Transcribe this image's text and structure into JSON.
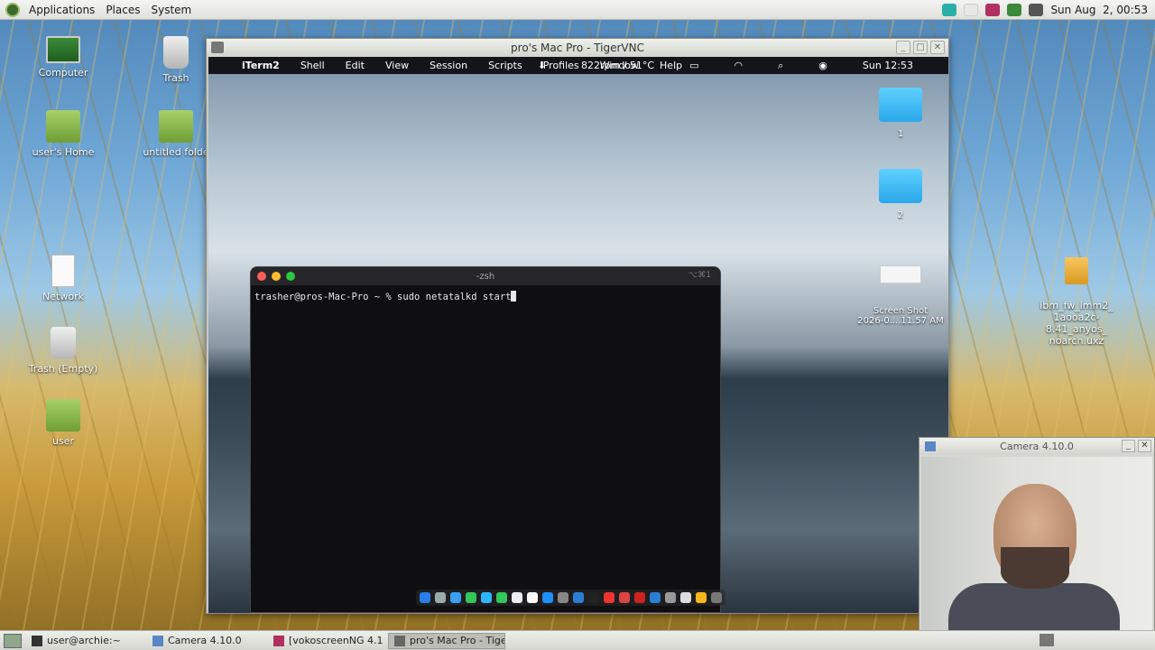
{
  "top_panel": {
    "menus": [
      "Applications",
      "Places",
      "System"
    ],
    "clock": "Sun Aug  2, 00:53"
  },
  "desktop_icons": [
    {
      "label": "Computer"
    },
    {
      "label": "Trash"
    },
    {
      "label": "user's Home"
    },
    {
      "label": "untitled folde"
    },
    {
      "label": "Network"
    },
    {
      "label": "Trash (Empty)"
    },
    {
      "label": "user"
    },
    {
      "label": "ibm_fw_imm2_\n1aooa2c-8.41_anyos_\nnoarch.uxz"
    }
  ],
  "vnc_window": {
    "title": "pro's Mac Pro - TigerVNC",
    "mac_menubar": {
      "app": "iTerm2",
      "items": [
        "Shell",
        "Edit",
        "View",
        "Session",
        "Scripts",
        "Profiles",
        "Window",
        "Help"
      ],
      "status": "822rpm / 51°C",
      "clock": "Sun 12:53"
    },
    "mac_icons": [
      {
        "label": "1"
      },
      {
        "label": "2"
      },
      {
        "label": "Screen Shot\n2026-0....11.57 AM"
      }
    ],
    "terminal": {
      "title": "-zsh",
      "shortcut": "⌥⌘1",
      "prompt": "trasher@pros-Mac-Pro ~ % ",
      "command": "sudo netatalkd start"
    }
  },
  "camera_window": {
    "title": "Camera 4.10.0"
  },
  "taskbar": {
    "items": [
      "user@archie:~",
      "Camera 4.10.0",
      "[vokoscreenNG 4.1...",
      "pro's Mac Pro - Tiger..."
    ]
  },
  "colors": {
    "terminal_bg": "#0f0f11",
    "mac_folder": "#2aa8ea"
  }
}
